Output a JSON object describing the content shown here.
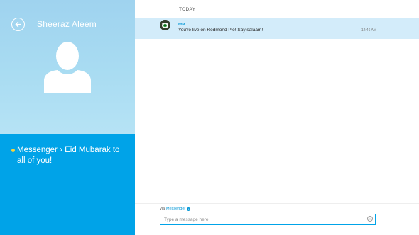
{
  "contact": {
    "name": "Sheeraz Aleem"
  },
  "status": {
    "message": "Messenger › Eid Mubarak to all of you!"
  },
  "conversation": {
    "day_header": "TODAY",
    "messages": [
      {
        "sender": "me",
        "text": "You're live on Redmond Pie! Say salaam!",
        "time": "12:46 AM"
      }
    ]
  },
  "compose": {
    "via_label": "via",
    "via_service": "Messenger",
    "placeholder": "Type a message here"
  },
  "icons": {
    "back": "back-arrow-icon",
    "avatar": "person-silhouette-icon",
    "status": "status-dot-icon",
    "info": "info-icon",
    "emoticon": "smiley-icon"
  },
  "colors": {
    "accent": "#00a3e8",
    "profile_bg": "#a9dcf2",
    "selected_row": "#d3ecfa",
    "link": "#0096d6",
    "status_dot": "#f7d33d"
  }
}
